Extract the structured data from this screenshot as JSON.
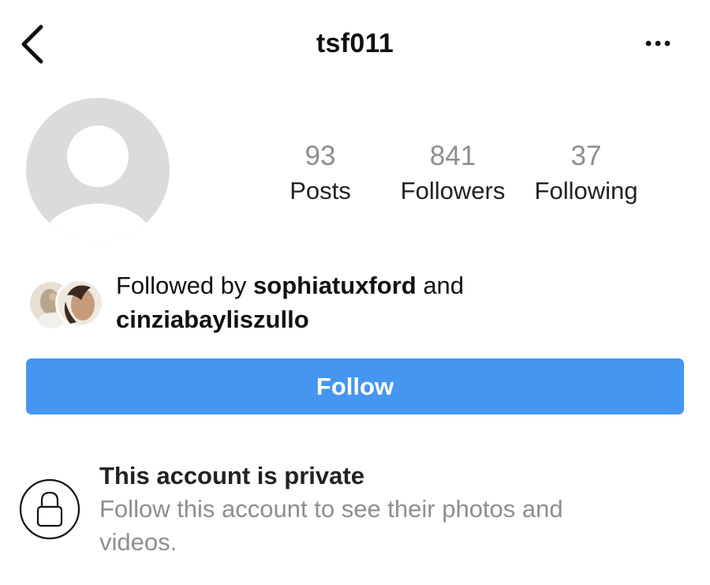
{
  "header": {
    "username": "tsf011",
    "back_icon": "chevron-left-icon",
    "more_icon": "ellipsis-horizontal-icon"
  },
  "profile": {
    "avatar_icon": "default-avatar-icon",
    "stats": {
      "posts_count": "93",
      "posts_label": "Posts",
      "followers_count": "841",
      "followers_label": "Followers",
      "following_count": "37",
      "following_label": "Following"
    }
  },
  "mutuals": {
    "prefix": "Followed by ",
    "user1": "sophiatuxford",
    "conjunction": " and",
    "user2": "cinziabayliszullo"
  },
  "actions": {
    "follow_label": "Follow",
    "follow_color": "#4596f0"
  },
  "privacy": {
    "icon": "lock-icon",
    "title": "This account is private",
    "description": "Follow this account to see their photos and videos."
  }
}
